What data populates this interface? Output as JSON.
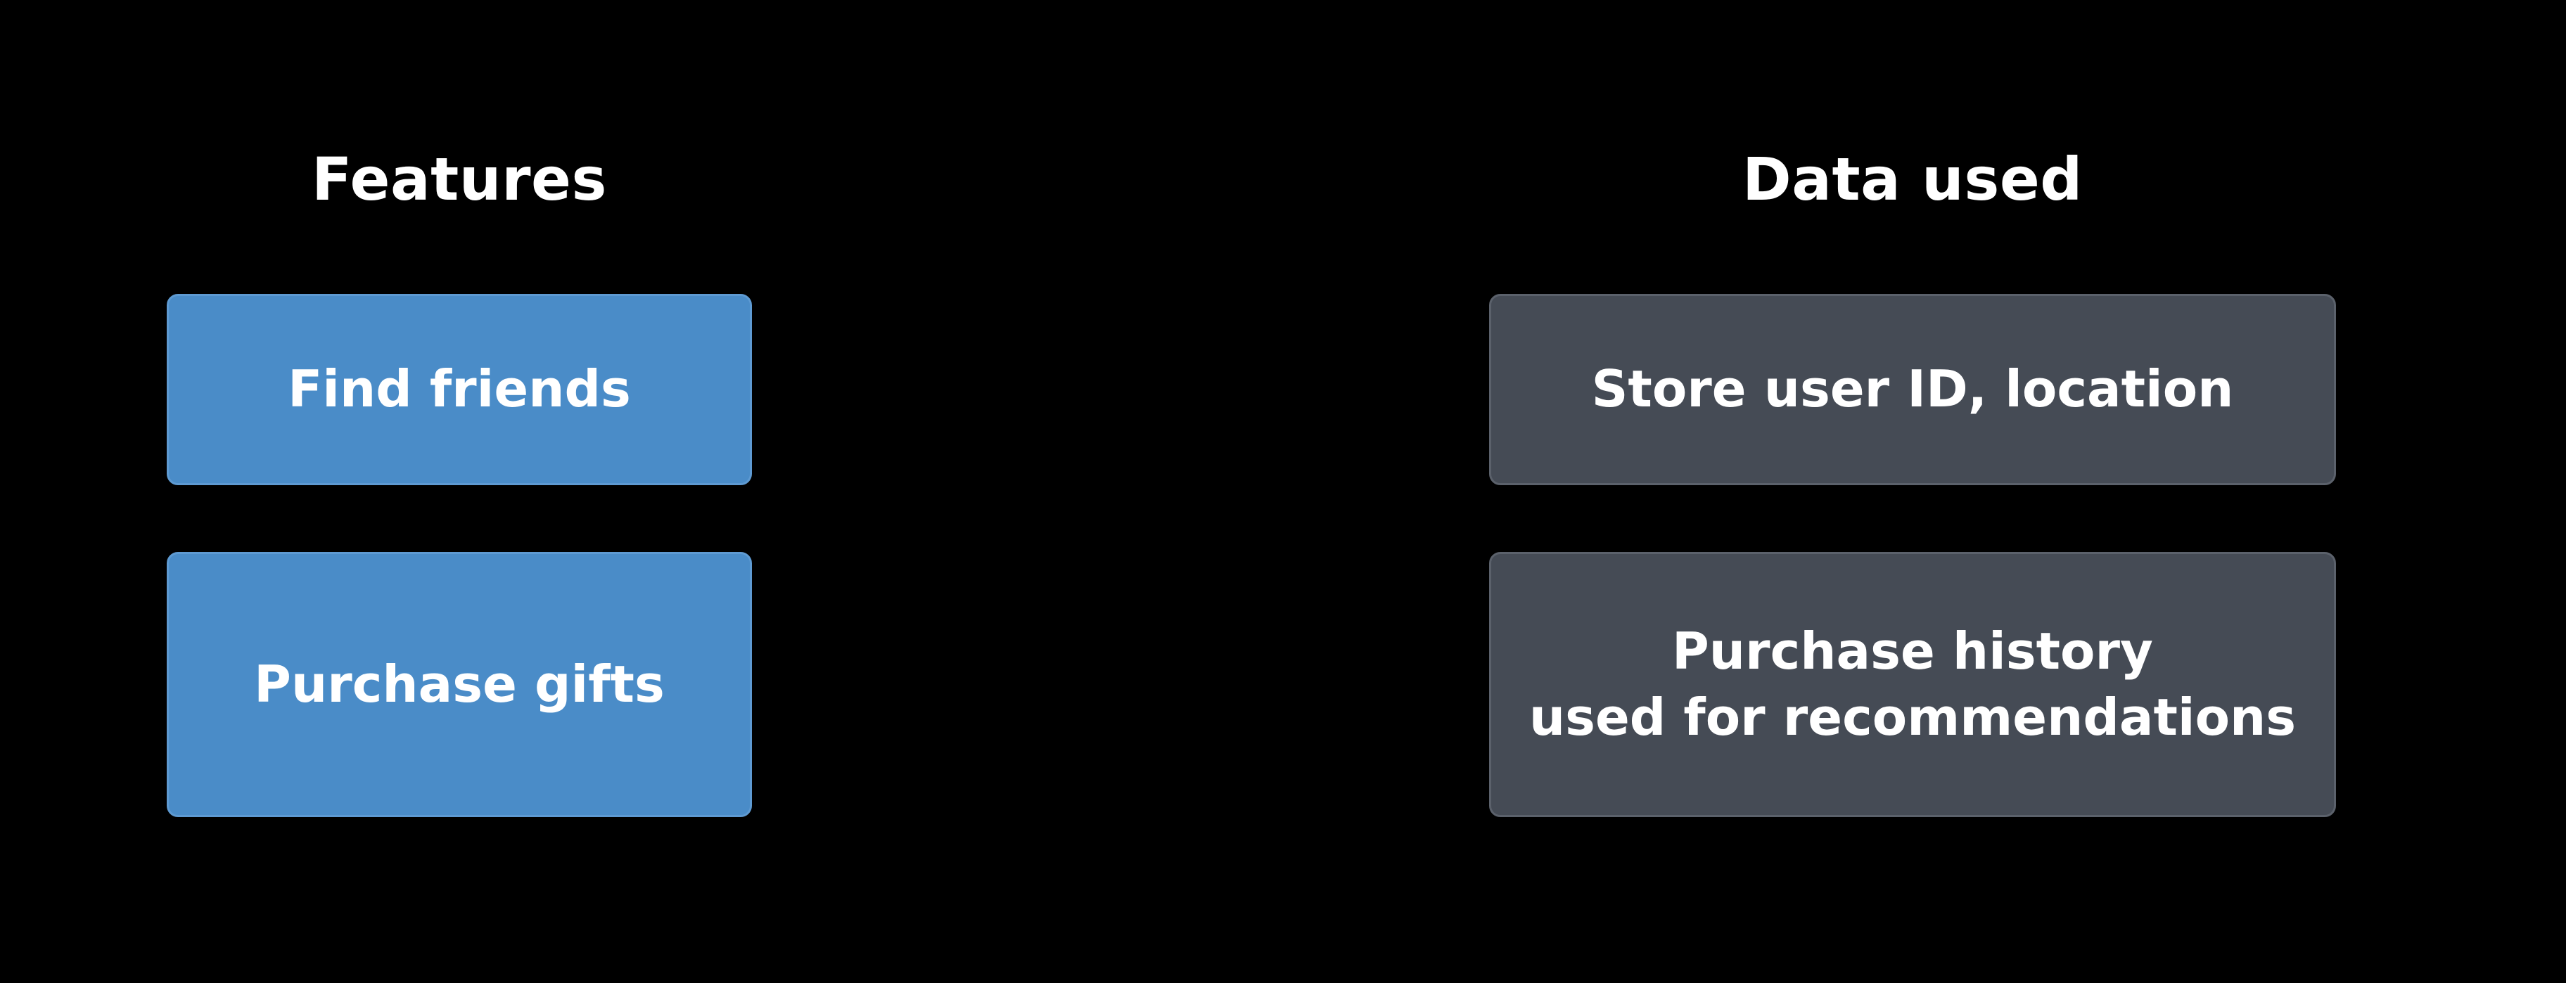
{
  "columns": {
    "features": {
      "title": "Features",
      "items": [
        "Find friends",
        "Purchase gifts"
      ]
    },
    "data_used": {
      "title": "Data used",
      "items": [
        "Store user ID, location",
        "Purchase history\nused for recommendations"
      ]
    }
  },
  "colors": {
    "background": "#000000",
    "feature_box": "#4a8cc8",
    "data_box": "#454b55",
    "text": "#ffffff"
  }
}
